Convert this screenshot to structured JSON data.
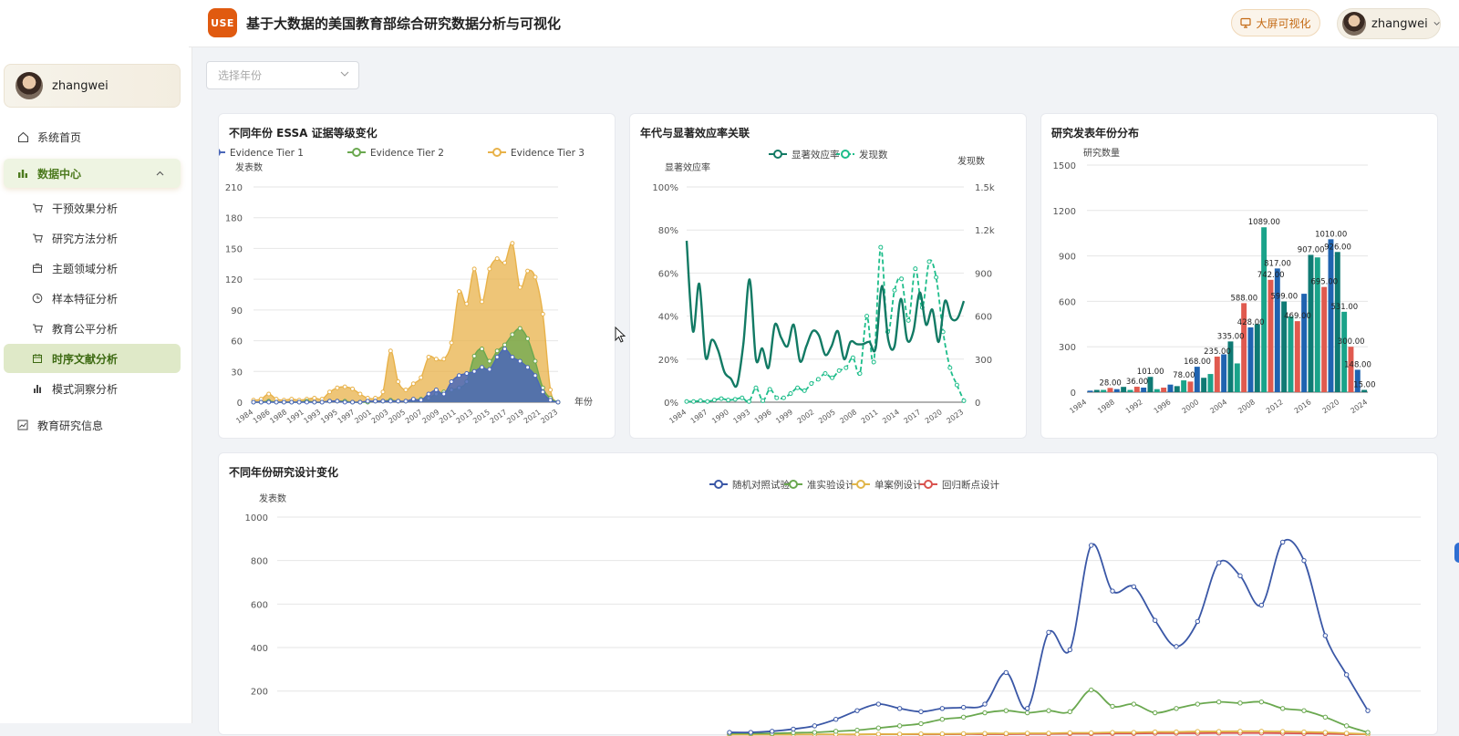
{
  "header": {
    "logo_text": "USE",
    "title": "基于大数据的美国教育部综合研究数据分析与可视化",
    "bigscreen_label": "大屏可视化",
    "username": "zhangwei"
  },
  "sidebar": {
    "username": "zhangwei",
    "items": [
      {
        "label": "系统首页",
        "icon": "home-icon"
      },
      {
        "label": "数据中心",
        "icon": "bar-chart-icon"
      },
      {
        "label": "干预效果分析",
        "icon": "cart-icon"
      },
      {
        "label": "研究方法分析",
        "icon": "cart-icon"
      },
      {
        "label": "主题领域分析",
        "icon": "box-icon"
      },
      {
        "label": "样本特征分析",
        "icon": "clock-icon"
      },
      {
        "label": "教育公平分析",
        "icon": "cart-icon"
      },
      {
        "label": "时序文献分析",
        "icon": "calendar-icon"
      },
      {
        "label": "模式洞察分析",
        "icon": "bars-icon"
      },
      {
        "label": "教育研究信息",
        "icon": "trend-icon"
      }
    ]
  },
  "filter": {
    "year_placeholder": "选择年份"
  },
  "colors": {
    "tier1": "#4a67b8",
    "tier2": "#6aa84f",
    "tier3": "#e8b24a",
    "teal": "#127a64",
    "green": "#1dbd8a",
    "rct": "#3a57a6",
    "quasi": "#6aa84f",
    "single": "#e0b54a",
    "rdd": "#d9534f"
  },
  "chart_data": [
    {
      "type": "area",
      "title": "不同年份 ESSA 证据等级变化",
      "ylabel": "发表数",
      "xlabel": "年份",
      "ylim": [
        0,
        210
      ],
      "yticks": [
        "0",
        "30",
        "60",
        "90",
        "120",
        "150",
        "180",
        "210"
      ],
      "x": [
        1984,
        1985,
        1986,
        1987,
        1988,
        1989,
        1990,
        1991,
        1992,
        1993,
        1994,
        1995,
        1996,
        1997,
        1998,
        1999,
        2000,
        2001,
        2002,
        2003,
        2004,
        2005,
        2006,
        2007,
        2008,
        2009,
        2010,
        2011,
        2012,
        2013,
        2014,
        2015,
        2016,
        2017,
        2018,
        2019,
        2020,
        2021,
        2022,
        2023,
        2024
      ],
      "xticklabels": [
        "1984",
        "1986",
        "1988",
        "1991",
        "1993",
        "1995",
        "1997",
        "2001",
        "2003",
        "2005",
        "2007",
        "2009",
        "2011",
        "2013",
        "2015",
        "2017",
        "2019",
        "2021",
        "2023"
      ],
      "series": [
        {
          "name": "Evidence Tier 1",
          "values": [
            0,
            0,
            0,
            0,
            0,
            0,
            0,
            0,
            0,
            0,
            1,
            1,
            0,
            0,
            0,
            1,
            1,
            1,
            1,
            1,
            1,
            3,
            2,
            8,
            12,
            8,
            20,
            26,
            28,
            30,
            34,
            32,
            44,
            52,
            44,
            40,
            34,
            26,
            10,
            2,
            0
          ]
        },
        {
          "name": "Evidence Tier 2",
          "values": [
            0,
            0,
            1,
            0,
            0,
            0,
            0,
            1,
            0,
            0,
            1,
            1,
            1,
            0,
            0,
            0,
            1,
            1,
            2,
            1,
            1,
            2,
            3,
            4,
            8,
            10,
            12,
            14,
            20,
            45,
            52,
            40,
            50,
            56,
            66,
            72,
            62,
            40,
            14,
            4,
            0
          ]
        },
        {
          "name": "Evidence Tier 3",
          "values": [
            2,
            3,
            8,
            3,
            2,
            3,
            2,
            3,
            4,
            3,
            10,
            14,
            15,
            13,
            8,
            4,
            4,
            10,
            50,
            20,
            12,
            18,
            24,
            44,
            42,
            42,
            58,
            108,
            96,
            130,
            98,
            130,
            140,
            136,
            155,
            112,
            128,
            122,
            86,
            12,
            0
          ]
        }
      ]
    },
    {
      "type": "line",
      "title": "年代与显著效应率关联",
      "ylabel": "显著效应率",
      "y2label": "发现数",
      "ylim": [
        0,
        100
      ],
      "y2lim": [
        0,
        1500
      ],
      "yticks": [
        "0%",
        "20%",
        "40%",
        "60%",
        "80%",
        "100%"
      ],
      "y2ticks": [
        "0",
        "300",
        "600",
        "900",
        "1.2k",
        "1.5k"
      ],
      "xticklabels": [
        "1984",
        "1987",
        "1990",
        "1993",
        "1996",
        "1999",
        "2002",
        "2005",
        "2008",
        "2011",
        "2014",
        "2017",
        "2020",
        "2023"
      ],
      "series": [
        {
          "name": "显著效应率",
          "values": [
            75,
            33,
            55,
            21,
            29,
            24,
            14,
            11,
            8,
            27,
            57,
            20,
            25,
            16,
            36,
            30,
            26,
            36,
            19,
            26,
            33,
            31,
            22,
            26,
            33,
            20,
            28,
            27,
            27,
            28,
            25,
            54,
            29,
            26,
            48,
            29,
            33,
            51,
            36,
            43,
            28,
            47,
            39,
            39,
            47
          ]
        },
        {
          "name": "发现数",
          "values": [
            5,
            5,
            10,
            5,
            15,
            25,
            15,
            20,
            30,
            5,
            100,
            10,
            90,
            30,
            30,
            60,
            100,
            80,
            130,
            160,
            200,
            170,
            220,
            240,
            310,
            200,
            600,
            280,
            1080,
            490,
            780,
            860,
            570,
            930,
            660,
            980,
            870,
            490,
            240,
            120,
            10
          ]
        }
      ]
    },
    {
      "type": "bar",
      "title": "研究发表年份分布",
      "ylabel": "研究数量",
      "ylim": [
        0,
        1500
      ],
      "yticks": [
        "0",
        "300",
        "600",
        "900",
        "1200",
        "1500"
      ],
      "xticklabels": [
        "1984",
        "1988",
        "1992",
        "1996",
        "2000",
        "2004",
        "2008",
        "2012",
        "2016",
        "2020",
        "2024"
      ],
      "data_labels": [
        "28.00",
        "36.00",
        "101.00",
        "78.00",
        "168.00",
        "235.00",
        "335.00",
        "428.00",
        "588.00",
        "742.00",
        "1089.00",
        "817.00",
        "599.00",
        "469.00",
        "907.00",
        "695.00",
        "1010.00",
        "926.00",
        "531.00",
        "300.00",
        "148.00",
        "15.00"
      ],
      "values": [
        10,
        15,
        15,
        28,
        20,
        35,
        15,
        36,
        30,
        101,
        20,
        30,
        50,
        40,
        78,
        70,
        168,
        95,
        120,
        235,
        250,
        335,
        190,
        588,
        428,
        450,
        1089,
        742,
        817,
        599,
        500,
        469,
        650,
        907,
        890,
        695,
        1010,
        926,
        531,
        300,
        148,
        15
      ]
    },
    {
      "type": "line",
      "title": "不同年份研究设计变化",
      "ylabel": "发表数",
      "ylim": [
        0,
        1000
      ],
      "yticks": [
        "200",
        "400",
        "600",
        "800",
        "1000"
      ],
      "series": [
        {
          "name": "随机对照试验",
          "values": [
            10,
            10,
            15,
            25,
            40,
            70,
            110,
            140,
            120,
            105,
            120,
            125,
            140,
            285,
            120,
            470,
            390,
            870,
            660,
            680,
            525,
            405,
            520,
            790,
            730,
            595,
            885,
            800,
            455,
            275,
            110
          ]
        },
        {
          "name": "准实验设计",
          "values": [
            5,
            5,
            5,
            8,
            10,
            15,
            20,
            30,
            40,
            50,
            70,
            80,
            100,
            110,
            100,
            110,
            105,
            205,
            130,
            140,
            100,
            120,
            140,
            150,
            145,
            150,
            120,
            110,
            80,
            40,
            10
          ]
        },
        {
          "name": "单案例设计",
          "values": [
            0,
            0,
            0,
            0,
            1,
            1,
            1,
            2,
            2,
            3,
            3,
            4,
            5,
            5,
            6,
            6,
            8,
            8,
            10,
            10,
            12,
            12,
            14,
            14,
            15,
            15,
            14,
            12,
            10,
            6,
            2
          ]
        },
        {
          "name": "回归断点设计",
          "values": [
            0,
            0,
            0,
            0,
            0,
            0,
            0,
            1,
            1,
            1,
            1,
            2,
            2,
            2,
            3,
            3,
            4,
            4,
            5,
            5,
            6,
            6,
            6,
            7,
            7,
            7,
            6,
            5,
            4,
            2,
            1
          ]
        }
      ]
    }
  ]
}
